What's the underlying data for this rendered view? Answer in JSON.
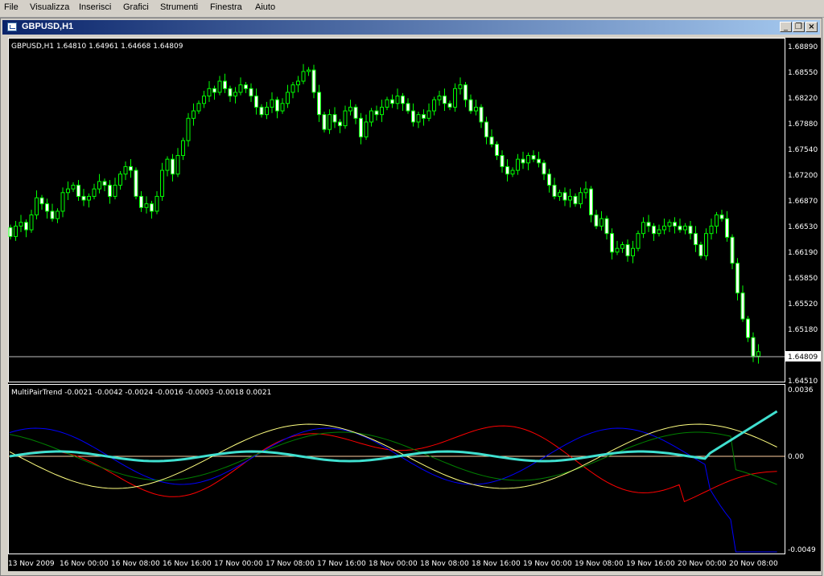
{
  "menu": [
    "File",
    "Visualizza",
    "Inserisci",
    "Grafici",
    "Strumenti",
    "Finestra",
    "Aiuto"
  ],
  "window": {
    "title": "GBPUSD,H1",
    "minimize_glyph": "_",
    "restore_glyph": "❐",
    "close_glyph": "×"
  },
  "price_panel": {
    "header": "GBPUSD,H1  1.64810 1.64961 1.64668 1.64809",
    "current_price_label": "1.64809",
    "axis_labels": [
      "1.68890",
      "1.68550",
      "1.68220",
      "1.67880",
      "1.67540",
      "1.67200",
      "1.66870",
      "1.66530",
      "1.66190",
      "1.65850",
      "1.65520",
      "1.65180",
      "1.64510"
    ]
  },
  "indicator_panel": {
    "header": "MultiPairTrend -0.0021 -0.0042 -0.0024 -0.0016 -0.0003 -0.0018 0.0021",
    "axis_labels": [
      "0.0036",
      "0.00",
      "-0.0049"
    ]
  },
  "time_axis": [
    "13 Nov 2009",
    "16 Nov 00:00",
    "16 Nov 08:00",
    "16 Nov 16:00",
    "17 Nov 00:00",
    "17 Nov 08:00",
    "17 Nov 16:00",
    "18 Nov 00:00",
    "18 Nov 08:00",
    "18 Nov 16:00",
    "19 Nov 00:00",
    "19 Nov 08:00",
    "19 Nov 16:00",
    "20 Nov 00:00",
    "20 Nov 08:00"
  ],
  "colors": {
    "background": "#000000",
    "candle": "#00ff00",
    "candle_bull_body": "#000000",
    "candle_bear_body": "#ffffff",
    "main_trend": "#40e0d0",
    "series_red": "#ff0000",
    "series_blue": "#0000ff",
    "series_green": "#008000",
    "series_yellow": "#ffff80"
  },
  "chart_data": {
    "type": "candlestick",
    "y_range": [
      1.6444,
      1.6898
    ],
    "candles_close": [
      1.6636,
      1.665,
      1.6655,
      1.6645,
      1.6665,
      1.6688,
      1.668,
      1.667,
      1.666,
      1.667,
      1.6695,
      1.67,
      1.6705,
      1.669,
      1.6685,
      1.669,
      1.67,
      1.671,
      1.6705,
      1.669,
      1.6705,
      1.672,
      1.673,
      1.6725,
      1.669,
      1.6675,
      1.668,
      1.667,
      1.669,
      1.6725,
      1.674,
      1.672,
      1.6745,
      1.6765,
      1.6795,
      1.6805,
      1.6815,
      1.6825,
      1.6835,
      1.683,
      1.6845,
      1.6835,
      1.6825,
      1.683,
      1.684,
      1.6835,
      1.6825,
      1.681,
      1.68,
      1.681,
      1.682,
      1.6805,
      1.6815,
      1.683,
      1.684,
      1.6845,
      1.6858,
      1.686,
      1.683,
      1.68,
      1.678,
      1.68,
      1.679,
      1.6785,
      1.6805,
      1.681,
      1.6795,
      1.677,
      1.679,
      1.6805,
      1.68,
      1.681,
      1.682,
      1.6815,
      1.6825,
      1.6815,
      1.6805,
      1.679,
      1.68,
      1.6795,
      1.6805,
      1.682,
      1.6825,
      1.6815,
      1.681,
      1.6835,
      1.684,
      1.682,
      1.6805,
      1.681,
      1.679,
      1.677,
      1.676,
      1.6745,
      1.673,
      1.672,
      1.6725,
      1.674,
      1.6735,
      1.6745,
      1.674,
      1.6735,
      1.672,
      1.6705,
      1.669,
      1.6695,
      1.6685,
      1.669,
      1.668,
      1.6695,
      1.67,
      1.6665,
      1.665,
      1.666,
      1.664,
      1.6615,
      1.662,
      1.6625,
      1.661,
      1.662,
      1.664,
      1.6655,
      1.665,
      1.664,
      1.6645,
      1.665,
      1.6655,
      1.665,
      1.6645,
      1.665,
      1.664,
      1.6625,
      1.661,
      1.664,
      1.665,
      1.6665,
      1.666,
      1.6635,
      1.66,
      1.656,
      1.6525,
      1.65,
      1.6475,
      1.6481
    ],
    "main_trend_range": [
      -0.0049,
      0.0036
    ]
  }
}
